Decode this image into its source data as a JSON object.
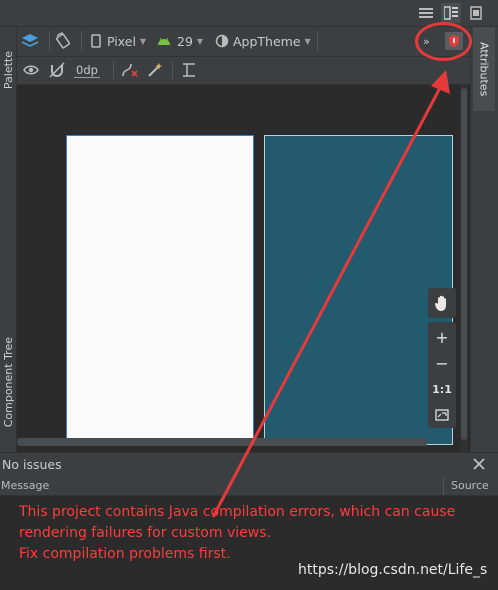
{
  "device": {
    "label": "Pixel"
  },
  "api": {
    "label": "29"
  },
  "theme": {
    "label": "AppTheme"
  },
  "toolbar2": {
    "margin_value": "0dp"
  },
  "left_panel": {
    "palette_label": "Palette",
    "component_tree_label": "Component Tree"
  },
  "right_panel": {
    "attributes_label": "Attributes"
  },
  "zoom": {
    "plus": "+",
    "minus": "−",
    "ratio": "1:1"
  },
  "issues": {
    "status": "No issues",
    "col_message": "Message",
    "col_source": "Source",
    "message_lines": [
      "This project contains Java compilation errors, which can cause",
      "rendering failures for custom views.",
      "Fix compilation problems first."
    ]
  },
  "watermark": "https://blog.csdn.net/Life_s",
  "colors": {
    "error_text": "#ff3c3c",
    "annotation": "#e63a3a",
    "blueprint": "#245a6e",
    "selection": "#3d7bd6"
  },
  "icons": [
    "list-view-icon",
    "split-view-icon",
    "design-view-icon",
    "layers-icon",
    "orientation-icon",
    "phone-icon",
    "android-icon",
    "theme-icon",
    "more-icon",
    "error-badge-icon",
    "eye-icon",
    "magnet-off-icon",
    "constraints-clear-icon",
    "magic-wand-icon",
    "guideline-icon",
    "hand-icon",
    "close-icon"
  ]
}
